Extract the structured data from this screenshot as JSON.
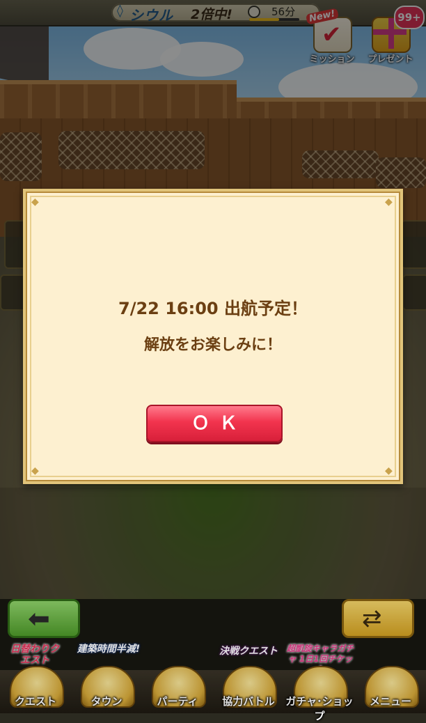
{
  "topbar": {
    "soul_label": "シウル",
    "double_label": "2倍中!",
    "time_left": "56分",
    "time_progress": 0.6,
    "mission_label": "ミッション",
    "mission_new": "New!",
    "present_label": "プレゼント",
    "present_badge": "99+"
  },
  "dialog": {
    "line1": "7/22 16:00 出航予定！",
    "line2": "解放をお楽しみに！",
    "ok_label": "ＯＫ"
  },
  "promos": {
    "daily": "日替わりクエスト",
    "construction": "建築時間半減!",
    "showdown": "決戦クエスト",
    "gacha": "超凱旋キャラガチャ 1日1回チケット"
  },
  "menu": [
    {
      "label": "クエスト",
      "icon": "quest-icon"
    },
    {
      "label": "タウン",
      "icon": "town-icon"
    },
    {
      "label": "パーティ",
      "icon": "party-icon"
    },
    {
      "label": "協力バトル",
      "icon": "coop-battle-icon"
    },
    {
      "label": "ガチャ･ショップ",
      "icon": "gacha-shop-icon"
    },
    {
      "label": "メニュー",
      "icon": "menu-icon"
    }
  ],
  "colors": {
    "ok_button": "#f2344e",
    "dialog_bg": "#fdf0d0",
    "dialog_text": "#6b3f12"
  }
}
